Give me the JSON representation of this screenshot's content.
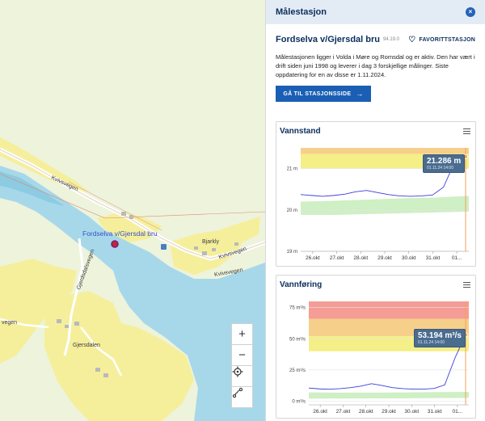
{
  "map": {
    "labels": {
      "kvivsvegen_1": "Kvivsvegen",
      "kvivsvegen_2": "Kvivsvegen",
      "kvivsvegen_3": "Kvivsvegen",
      "gjerdsdalsvegen": "Gjerdsdalsvegen",
      "gjersdalen": "Gjersdalen",
      "bjarkly": "Bjarkly",
      "vegen_left": "vegen"
    },
    "station_label": "Fordselva v/Gjersdal bru",
    "controls": {
      "zoom_in": "+",
      "zoom_out": "−"
    }
  },
  "panel": {
    "title": "Målestasjon",
    "close": "×",
    "station_name": "Fordselva v/Gjersdal bru",
    "station_id": "94.19.0",
    "favorite_label": "FAVORITTSTASJON",
    "description": "Målestasjonen ligger i Volda i Møre og Romsdal og er aktiv. Den har vært i drift siden juni 1998 og leverer i dag 3 forskjellige målinger. Siste oppdatering for en av disse er 1.11.2024.",
    "go_button": "GÅ TIL STASJONSSIDE"
  },
  "chart_data": [
    {
      "type": "line",
      "title": "Vannstand",
      "categories": [
        "26.okt",
        "27.okt",
        "28.okt",
        "29.okt",
        "30.okt",
        "31.okt",
        "01..."
      ],
      "y_ticks": [
        "21 m",
        "20 m",
        "19 m"
      ],
      "ylim": [
        19,
        21.5
      ],
      "tooltip": {
        "value": "21.286 m",
        "time": "01.11.24 14:00"
      },
      "series": [
        {
          "values": [
            20.37,
            20.35,
            20.33,
            20.35,
            20.38,
            20.44,
            20.47,
            20.42,
            20.37,
            20.34,
            20.33,
            20.34,
            20.36,
            20.55,
            21.15,
            21.29
          ]
        }
      ],
      "bands": [
        {
          "color": "#f59c95",
          "from": 21.55,
          "to": 21.85
        },
        {
          "color": "#f6cf8a",
          "from": 21.35,
          "to": 21.55
        },
        {
          "color": "#f4ef86",
          "from": 21.0,
          "to": 21.35
        }
      ],
      "normal_range": {
        "color": "#cfefc4",
        "lower": [
          19.88,
          19.88,
          19.9,
          19.92,
          19.94,
          19.96
        ],
        "upper": [
          20.2,
          20.22,
          20.25,
          20.28,
          20.3,
          20.34
        ]
      }
    },
    {
      "type": "line",
      "title": "Vannføring",
      "categories": [
        "26.okt",
        "27.okt",
        "28.okt",
        "29.okt",
        "30.okt",
        "31.okt",
        "01..."
      ],
      "y_ticks": [
        "75 m³/s",
        "50 m³/s",
        "25 m³/s",
        "0 m³/s"
      ],
      "ylim": [
        -3,
        80
      ],
      "tooltip": {
        "value": "53.194 m³/s",
        "time": "01.11.24 14:00"
      },
      "series": [
        {
          "values": [
            10.5,
            9.8,
            9.5,
            10,
            10.8,
            12,
            14,
            12.5,
            10.8,
            10,
            9.6,
            9.6,
            10.2,
            13,
            35,
            53.2
          ]
        }
      ],
      "bands": [
        {
          "color": "#f59c95",
          "from": 66,
          "to": 83
        },
        {
          "color": "#f6cf8a",
          "from": 52,
          "to": 66
        },
        {
          "color": "#f4ef86",
          "from": 40,
          "to": 52
        }
      ],
      "normal_range": {
        "color": "#cfefc4",
        "lower": [
          2,
          2,
          2.2,
          2.2,
          2.4,
          2.6
        ],
        "upper": [
          7,
          6.8,
          6.8,
          7,
          7.2,
          7.4
        ]
      }
    }
  ]
}
